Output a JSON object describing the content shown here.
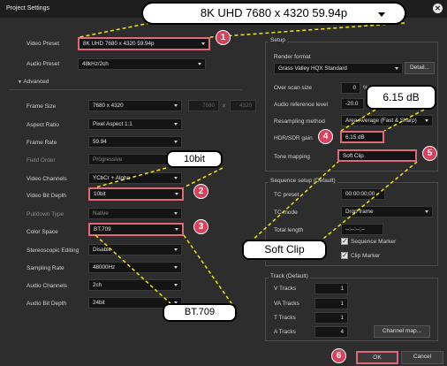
{
  "window": {
    "title": "Project Settings"
  },
  "callouts": {
    "top": "8K UHD 7680 x 4320 59.94p",
    "bitdepth": "10bit",
    "colorspace": "BT.709",
    "hdr_gain": "6.15 dB",
    "tone": "Soft Clip"
  },
  "badges": [
    "1",
    "2",
    "3",
    "4",
    "5",
    "6"
  ],
  "left": {
    "video_preset_label": "Video Preset",
    "video_preset": "8K UHD 7680 x 4320 59.94p",
    "audio_preset_label": "Audio Preset",
    "audio_preset": "48kHz/2ch",
    "advanced_label": "Advanced",
    "frame_size_label": "Frame Size",
    "frame_size": "7680 x 4320",
    "frame_w": "7680",
    "frame_x": "x",
    "frame_h": "4320",
    "aspect_label": "Aspect Ratio",
    "aspect": "Pixel Aspect 1:1",
    "frame_rate_label": "Frame Rate",
    "frame_rate": "59.94",
    "field_order_label": "Field Order",
    "field_order": "Progressive",
    "video_channels_label": "Video Channels",
    "video_channels": "YCbCr + Alpha",
    "bit_depth_label": "Video Bit Depth",
    "bit_depth": "10bit",
    "pulldown_label": "Pulldown Type",
    "pulldown": "Native",
    "color_space_label": "Color Space",
    "color_space": "BT.709",
    "stereo_label": "Stereoscopic Editing",
    "stereo": "Disable",
    "sampling_label": "Sampling Rate",
    "sampling": "48000Hz",
    "audio_channels_label": "Audio Channels",
    "audio_channels": "2ch",
    "audio_bit_label": "Audio Bit Depth",
    "audio_bit": "24bit"
  },
  "setup": {
    "group": "Setup",
    "render_format_label": "Render format",
    "render_format": "Grass Valley HQX Standard",
    "detail_btn": "Detail...",
    "overscan_label": "Over scan size",
    "overscan": "0",
    "overscan_unit": "%",
    "audio_ref_label": "Audio reference level",
    "audio_ref": "-20.0",
    "resampling_label": "Resampling method",
    "resampling": "Area Average (Fast & Sharp)",
    "hdr_label": "HDR/SDR gain",
    "hdr": "6.15 dB",
    "tone_label": "Tone mapping",
    "tone": "Soft Clip"
  },
  "sequence": {
    "group": "Sequence setup (Default)",
    "tc_preset_label": "TC preset",
    "tc_preset": "00:00:00;00",
    "tc_mode_label": "TC mode",
    "tc_mode": "Drop frame",
    "total_label": "Total length",
    "total": "--:--:--;--",
    "seq_marker": "Sequence Marker",
    "clip_marker": "Clip Marker"
  },
  "track": {
    "group": "Track (Default)",
    "v_label": "V Tracks",
    "v": "1",
    "va_label": "VA Tracks",
    "va": "1",
    "t_label": "T Tracks",
    "t": "1",
    "a_label": "A Tracks",
    "a": "4",
    "channel_map": "Channel map..."
  },
  "footer": {
    "ok": "OK",
    "cancel": "Cancel"
  }
}
